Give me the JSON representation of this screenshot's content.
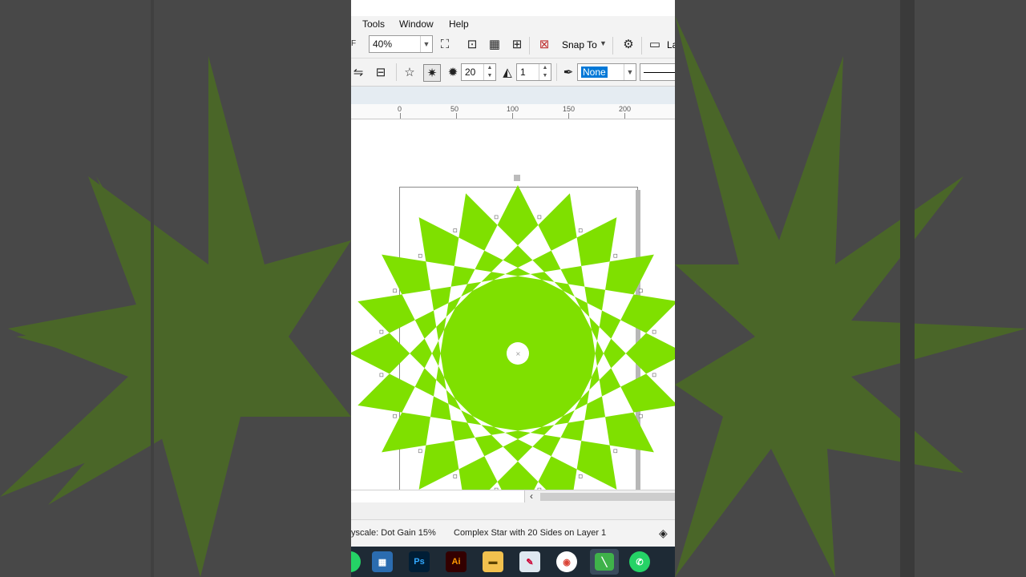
{
  "menu": {
    "tools": "Tools",
    "window": "Window",
    "help": "Help"
  },
  "toolbar": {
    "clipped_left_char": "F",
    "zoom_value": "40%",
    "snap_to_label": "Snap To",
    "clipped_right_label": "La"
  },
  "property_bar": {
    "points_value": "20",
    "sharpness_value": "1",
    "outline_value": "None"
  },
  "ruler": {
    "ticks": [
      "0",
      "50",
      "100",
      "150",
      "200"
    ]
  },
  "status": {
    "color_profile": "yscale: Dot Gain 15%",
    "selection_info": "Complex Star with 20 Sides on Layer 1"
  },
  "taskbar": {
    "items": [
      "whatsapp-partial",
      "calculator",
      "Ps",
      "Ai",
      "file-explorer",
      "paint",
      "chrome",
      "coreldraw",
      "whatsapp"
    ]
  },
  "colors": {
    "star_fill": "#7fe000",
    "accent": "#39a0d0",
    "taskbar": "#1e2a35"
  }
}
